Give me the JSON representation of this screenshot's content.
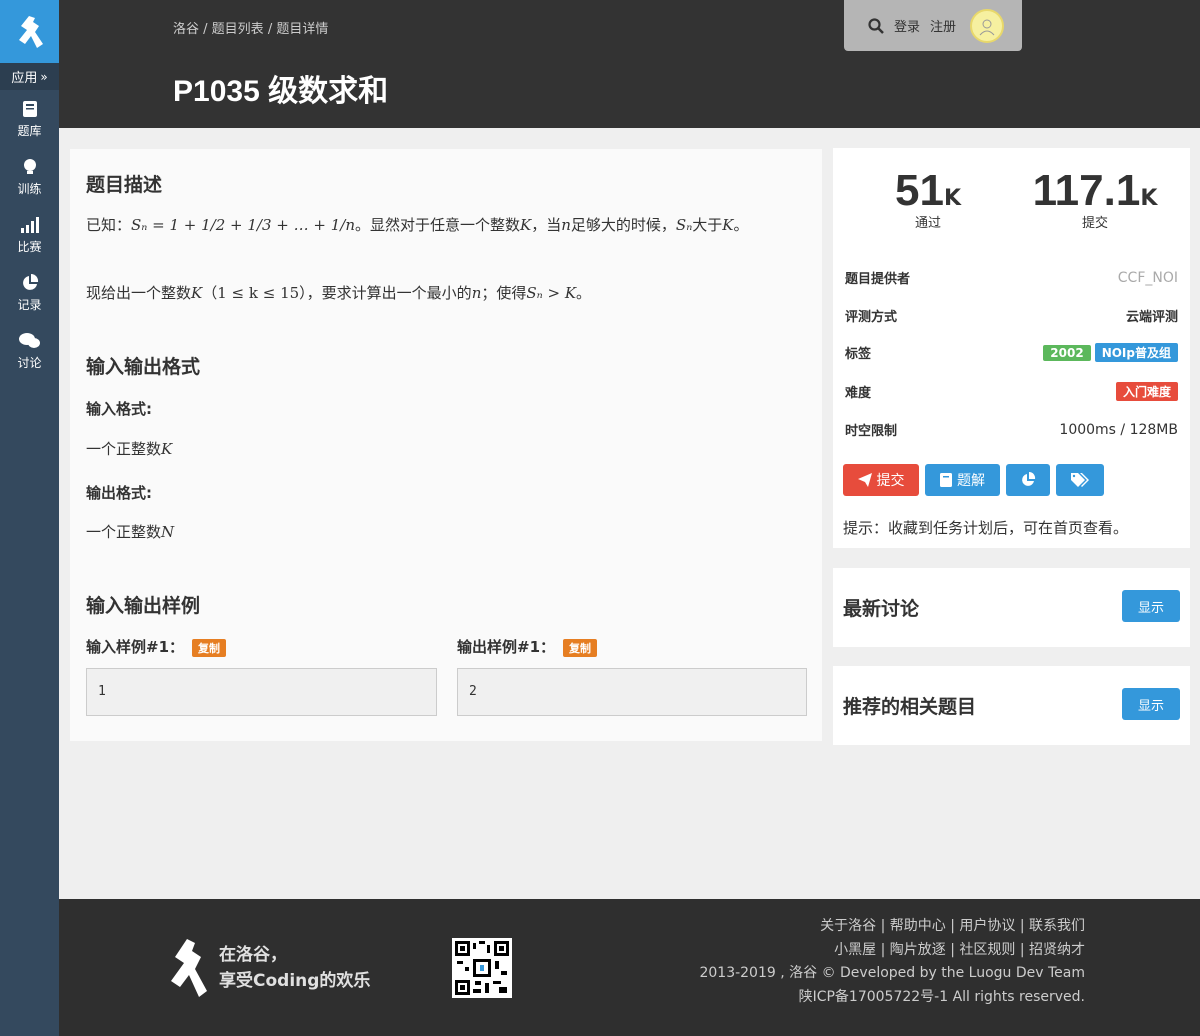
{
  "sidebar": {
    "app_label": "应用",
    "items": [
      {
        "label": "题库",
        "icon": "book-icon"
      },
      {
        "label": "训练",
        "icon": "lightbulb-icon"
      },
      {
        "label": "比赛",
        "icon": "bar-chart-icon"
      },
      {
        "label": "记录",
        "icon": "pie-chart-icon"
      },
      {
        "label": "讨论",
        "icon": "comments-icon"
      }
    ]
  },
  "header": {
    "breadcrumb": [
      "洛谷",
      "题目列表",
      "题目详情"
    ],
    "breadcrumb_sep": " / ",
    "title": "P1035 级数求和",
    "login": "登录",
    "register": "注册"
  },
  "problem": {
    "desc_title": "题目描述",
    "desc_p1_a": "已知：",
    "desc_p1_formula": "Sₙ = 1 + 1/2 + 1/3 + … + 1/n",
    "desc_p1_b": "。显然对于任意一个整数",
    "desc_p1_K": "K",
    "desc_p1_c": "，当",
    "desc_p1_n": "n",
    "desc_p1_d": "足够大的时候，",
    "desc_p1_Sn": "Sₙ",
    "desc_p1_e": "大于",
    "desc_p1_K2": "K",
    "desc_p1_f": "。",
    "desc_p2_a": "现给出一个整数",
    "desc_p2_K": "K",
    "desc_p2_range": "（1 ≤ k ≤ 15）",
    "desc_p2_b": "，要求计算出一个最小的",
    "desc_p2_n": "n",
    "desc_p2_c": "；使得",
    "desc_p2_ineq": "Sₙ > K",
    "desc_p2_d": "。",
    "io_title": "输入输出格式",
    "input_format_label": "输入格式:",
    "input_format_a": "一个正整数",
    "input_format_var": "K",
    "output_format_label": "输出格式:",
    "output_format_a": "一个正整数",
    "output_format_var": "N",
    "sample_title": "输入输出样例",
    "sample_in_label": "输入样例#1：",
    "sample_out_label": "输出样例#1：",
    "copy_label": "复制",
    "sample_in": "1",
    "sample_out": "2"
  },
  "info": {
    "passed_num": "51",
    "passed_unit": "K",
    "passed_label": "通过",
    "submitted_num": "117.1",
    "submitted_unit": "K",
    "submitted_label": "提交",
    "provider_key": "题目提供者",
    "provider_val": "CCF_NOI",
    "judge_key": "评测方式",
    "judge_val": "云端评测",
    "tags_key": "标签",
    "tags": [
      {
        "label": "2002",
        "color": "#5cb85c"
      },
      {
        "label": "NOIp普及组",
        "color": "#3498db"
      }
    ],
    "difficulty_key": "难度",
    "difficulty_val": "入门难度",
    "difficulty_color": "#e74c3c",
    "limit_key": "时空限制",
    "limit_val": "1000ms / 128MB",
    "submit_btn": "提交",
    "solution_btn": "题解",
    "hint": "提示：收藏到任务计划后，可在首页查看。"
  },
  "discussion": {
    "title": "最新讨论",
    "show": "显示"
  },
  "related": {
    "title": "推荐的相关题目",
    "show": "显示"
  },
  "footer": {
    "slogan_1": "在洛谷，",
    "slogan_2": "享受Coding的欢乐",
    "links_1": "关于洛谷 | 帮助中心 | 用户协议 | 联系我们",
    "links_2": "小黑屋 | 陶片放逐 | 社区规则 | 招贤纳才",
    "copyright": "2013-2019 , 洛谷 © Developed by the Luogu Dev Team",
    "icp": "陕ICP备17005722号-1 All rights reserved."
  },
  "colors": {
    "accent": "#3498db",
    "sidebar": "#34495e",
    "header": "#333333",
    "danger": "#e74c3c",
    "orange": "#e67e22"
  }
}
